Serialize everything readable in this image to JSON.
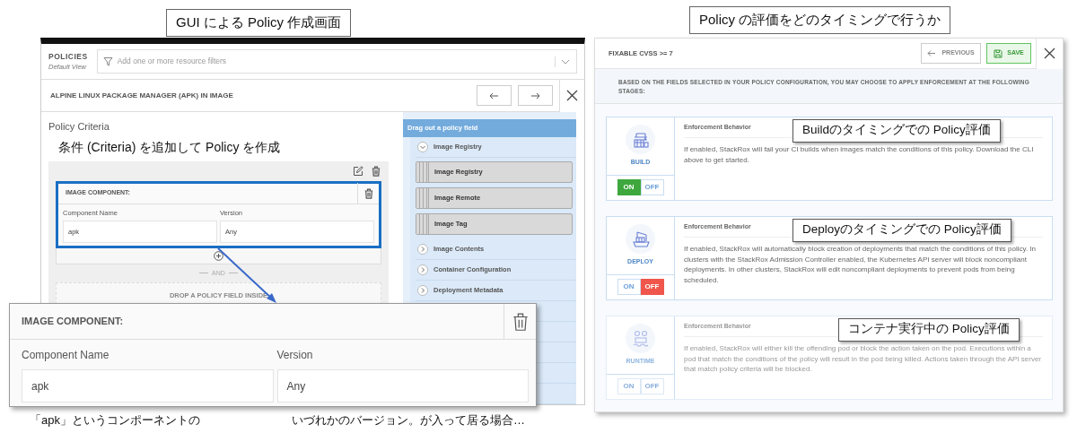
{
  "captions": [
    "GUI による Policy 作成画面",
    "Policy の評価をどのタイミングで行うか"
  ],
  "criteria_screen": {
    "header": {
      "title": "POLICIES",
      "subtitle": "Default View",
      "filter_placeholder": "Add one or more resource filters"
    },
    "policy_title": "ALPINE LINUX PACKAGE MANAGER (APK) IN IMAGE",
    "section_title": "Policy Criteria",
    "callout": "条件 (Criteria) を追加して Policy を作成",
    "group": {
      "title": "IMAGE COMPONENT:",
      "fields": [
        {
          "label": "Component Name",
          "value": "apk"
        },
        {
          "label": "Version",
          "value": "Any"
        }
      ]
    },
    "and_label": "AND",
    "drop_zone": "DROP A POLICY FIELD INSIDE",
    "field_panel": {
      "title": "Drag out a policy field",
      "categories": [
        {
          "label": "Image Registry",
          "expanded": true,
          "children": [
            {
              "label": "Image Registry"
            },
            {
              "label": "Image Remote"
            },
            {
              "label": "Image Tag"
            }
          ]
        },
        {
          "label": "Image Contents",
          "expanded": false
        },
        {
          "label": "Container Configuration",
          "expanded": false
        },
        {
          "label": "Deployment Metadata",
          "expanded": false
        }
      ]
    },
    "inset": {
      "title": "IMAGE COMPONENT:",
      "fields": [
        {
          "label": "Component Name",
          "value": "apk"
        },
        {
          "label": "Version",
          "value": "Any"
        }
      ]
    },
    "notes": [
      "「apk」というコンポーネントの",
      "いづれかのバージョン。が入って居る場合…"
    ]
  },
  "stage_screen": {
    "title": "FIXABLE CVSS >= 7",
    "previous_button": "PREVIOUS",
    "save_button": "SAVE",
    "intro": "BASED ON THE FIELDS SELECTED IN YOUR POLICY CONFIGURATION, YOU MAY CHOOSE TO APPLY ENFORCEMENT AT THE FOLLOWING STAGES:",
    "stages": [
      {
        "kind": "build",
        "name": "BUILD",
        "heading": "Enforcement Behavior",
        "description": "If enabled, StackRox will fail your CI builds when images match the conditions of this policy. Download the CLI above to get started.",
        "on_label": "ON",
        "off_label": "OFF",
        "enforced": true,
        "disabled": false,
        "callout": "Buildのタイミングでの Policy評価"
      },
      {
        "kind": "deploy",
        "name": "DEPLOY",
        "heading": "Enforcement Behavior",
        "description": "If enabled, StackRox will automatically block creation of deployments that match the conditions of this policy. In clusters with the StackRox Admission Controller enabled, the Kubernetes API server will block noncompliant deployments. In other clusters, StackRox will edit noncompliant deployments to prevent pods from being scheduled.",
        "on_label": "ON",
        "off_label": "OFF",
        "enforced": false,
        "disabled": false,
        "callout": "Deployのタイミングでの Policy評価"
      },
      {
        "kind": "runtime",
        "name": "RUNTIME",
        "heading": "Enforcement Behavior",
        "description": "If enabled, StackRox will either kill the offending pod or block the action taken on the pod. Executions within a pod that match the conditions of the policy will result in the pod being killed. Actions taken through the API server that match policy criteria will be blocked.",
        "on_label": "ON",
        "off_label": "OFF",
        "disabled": true,
        "callout": "コンテナ実行中の Policy評価"
      }
    ]
  }
}
